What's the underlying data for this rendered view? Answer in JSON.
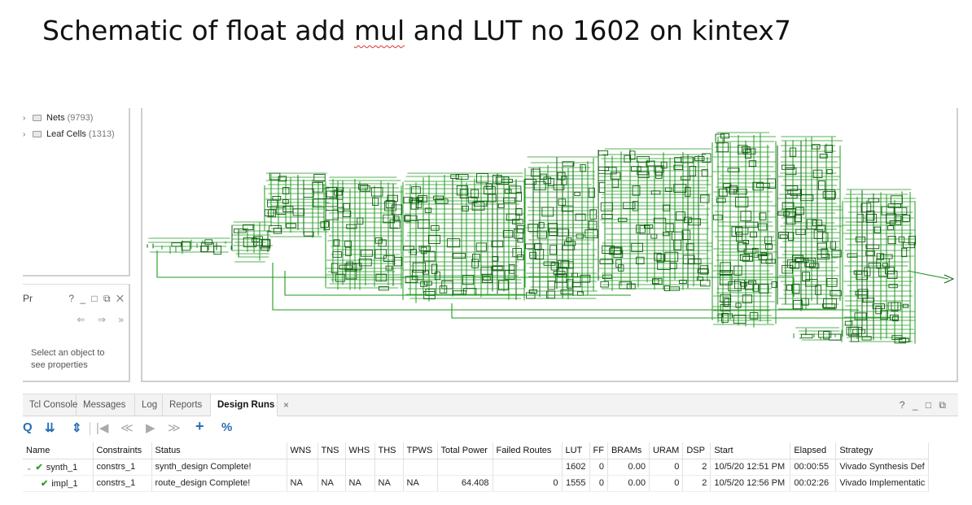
{
  "slide": {
    "title_pre": "Schematic of float add ",
    "title_squig": "mul",
    "title_post": " and LUT no 1602 on kintex7"
  },
  "tree": {
    "items": [
      {
        "label": "Nets",
        "count": "(9793)"
      },
      {
        "label": "Leaf Cells",
        "count": "(1313)"
      }
    ]
  },
  "properties": {
    "header": "Pr",
    "controls": "? _ □ ⧉ ✕",
    "nav_back": "⇐",
    "nav_fwd": "⇒",
    "nav_more": "»",
    "empty_message": "Select an object to see properties"
  },
  "bottom": {
    "tabs": [
      {
        "label": "Tcl Console"
      },
      {
        "label": "Messages"
      },
      {
        "label": "Log"
      },
      {
        "label": "Reports"
      },
      {
        "label": "Design Runs"
      }
    ],
    "close_label": "×",
    "panel_controls": "? _ □ ⧉",
    "toolbar": {
      "search": "Q",
      "collapse": "⇊",
      "expand": "⇕",
      "first": "|◀",
      "prev": "≪",
      "play": "▶",
      "next": "≫",
      "add": "+",
      "percent": "%"
    },
    "runs": {
      "columns": [
        "Name",
        "Constraints",
        "Status",
        "WNS",
        "TNS",
        "WHS",
        "THS",
        "TPWS",
        "Total Power",
        "Failed Routes",
        "LUT",
        "FF",
        "BRAMs",
        "URAM",
        "DSP",
        "Start",
        "Elapsed",
        "Strategy"
      ],
      "rows": [
        {
          "name": "synth_1",
          "constraints": "constrs_1",
          "status": "synth_design Complete!",
          "wns": "",
          "tns": "",
          "whs": "",
          "ths": "",
          "tpws": "",
          "power": "",
          "failed": "",
          "lut": "1602",
          "ff": "0",
          "brams": "0.00",
          "uram": "0",
          "dsp": "2",
          "start": "10/5/20 12:51 PM",
          "elapsed": "00:00:55",
          "strategy": "Vivado Synthesis Def"
        },
        {
          "name": "impl_1",
          "constraints": "constrs_1",
          "status": "route_design Complete!",
          "wns": "NA",
          "tns": "NA",
          "whs": "NA",
          "ths": "NA",
          "tpws": "NA",
          "power": "64.408",
          "failed": "0",
          "lut": "1555",
          "ff": "0",
          "brams": "0.00",
          "uram": "0",
          "dsp": "2",
          "start": "10/5/20 12:56 PM",
          "elapsed": "00:02:26",
          "strategy": "Vivado Implementatic"
        }
      ]
    }
  },
  "colors": {
    "schematic_green": "#1f9a1f",
    "schematic_dark": "#0d5e0d",
    "accent_blue": "#2a6db3",
    "check_green": "#2f9e2f"
  }
}
